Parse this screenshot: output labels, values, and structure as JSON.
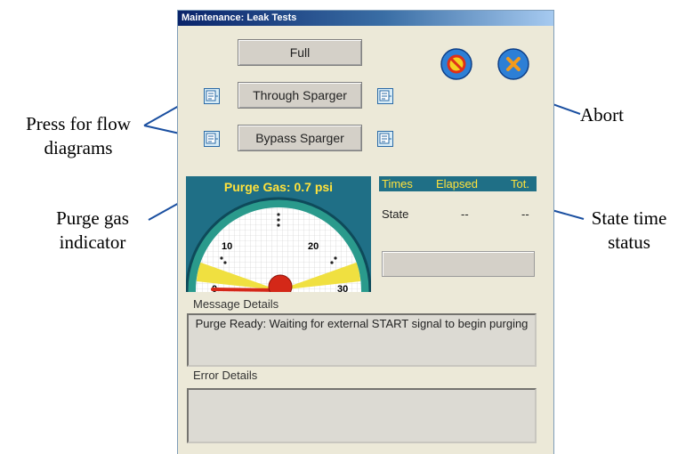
{
  "window": {
    "title": "Maintenance: Leak Tests"
  },
  "buttons": {
    "full": "Full",
    "through": "Through Sparger",
    "bypass": "Bypass Sparger"
  },
  "gauge": {
    "title": "Purge Gas: 0.7  psi",
    "value_psi": 0.7,
    "ticks": [
      "0",
      "10",
      "20",
      "30"
    ],
    "range": [
      0,
      30
    ]
  },
  "times": {
    "header": {
      "times": "Times",
      "elapsed": "Elapsed",
      "total": "Tot."
    },
    "state": {
      "label": "State",
      "elapsed": "--",
      "total": "--"
    }
  },
  "message": {
    "label": "Message Details",
    "text": "Purge Ready: Waiting for external START signal to begin purging"
  },
  "error": {
    "label": "Error Details",
    "text": ""
  },
  "annotations": {
    "flow": "Press for flow diagrams",
    "purge": "Purge gas indicator",
    "abort": "Abort",
    "state_time": "State time status"
  },
  "colors": {
    "panel_teal": "#1f6f86",
    "title_yellow": "#ffe23c",
    "abort_blue": "#2d7fd6",
    "stop_red": "#e03018",
    "cancel_orange": "#f39a1c",
    "leader_blue": "#1a4fa0"
  },
  "icons": {
    "flow_diagram": "flow-diagram-icon",
    "abort": "stop-sign-icon",
    "cancel": "cancel-x-icon"
  }
}
